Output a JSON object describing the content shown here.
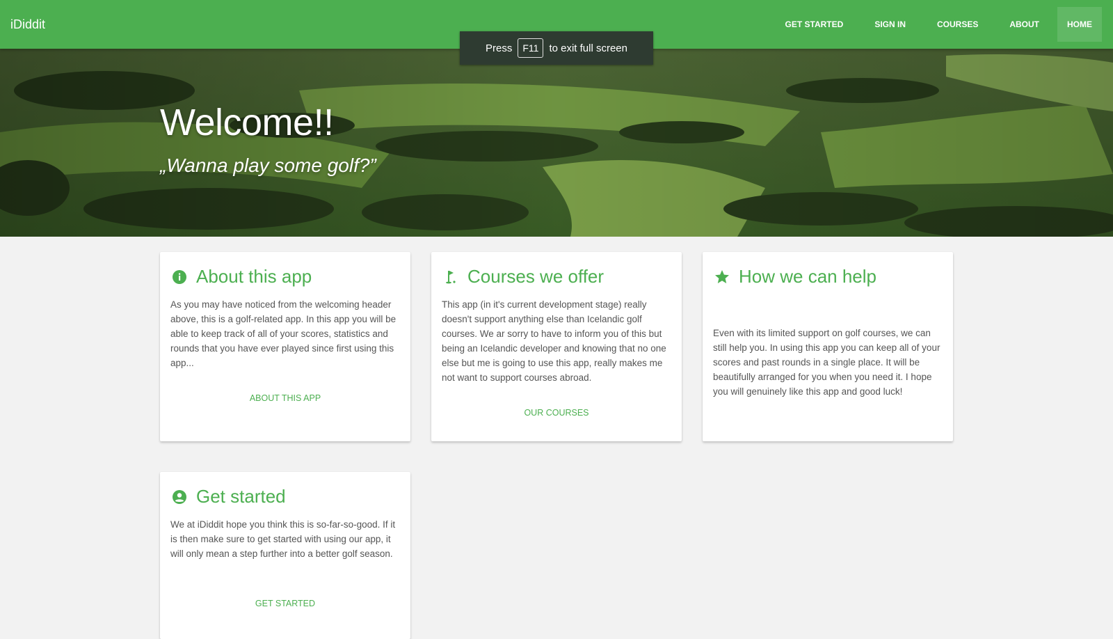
{
  "nav": {
    "brand": "iDiddit",
    "links": [
      "GET STARTED",
      "SIGN IN",
      "COURSES",
      "ABOUT",
      "HOME"
    ],
    "active": "HOME"
  },
  "fullscreen_toast": {
    "prefix": "Press",
    "key": "F11",
    "suffix": "to exit full screen"
  },
  "hero": {
    "title": "Welcome!!",
    "subtitle": "„Wanna play some golf?”"
  },
  "cards": [
    {
      "icon": "info-icon",
      "title": "About this app",
      "text": "As you may have noticed from the welcoming header above, this is a golf-related app. In this app you will be able to keep track of all of your scores, statistics and rounds that you have ever played since first using this app...",
      "action": "ABOUT THIS APP"
    },
    {
      "icon": "golf-flag-icon",
      "title": "Courses we offer",
      "text": "This app (in it's current development stage) really doesn't support anything else than Icelandic golf courses. We ar sorry to have to inform you of this but being an Icelandic developer and knowing that no one else but me is going to use this app, really makes me not want to support courses abroad.",
      "action": "OUR COURSES"
    },
    {
      "icon": "star-icon",
      "title": "How we can help",
      "text": "Even with its limited support on golf courses, we can still help you. In using this app you can keep all of your scores and past rounds in a single place. It will be beautifully arranged for you when you need it. I hope you will genuinely like this app and good luck!",
      "action": ""
    },
    {
      "icon": "account-circle-icon",
      "title": "Get started",
      "text": "We at iDiddit hope you think this is so-far-so-good. If it is then make sure to get started with using our app, it will only mean a step further into a better golf season.",
      "action": "GET STARTED"
    }
  ],
  "colors": {
    "primary": "#4caf50",
    "background": "#f2f2f2",
    "card": "#ffffff"
  }
}
